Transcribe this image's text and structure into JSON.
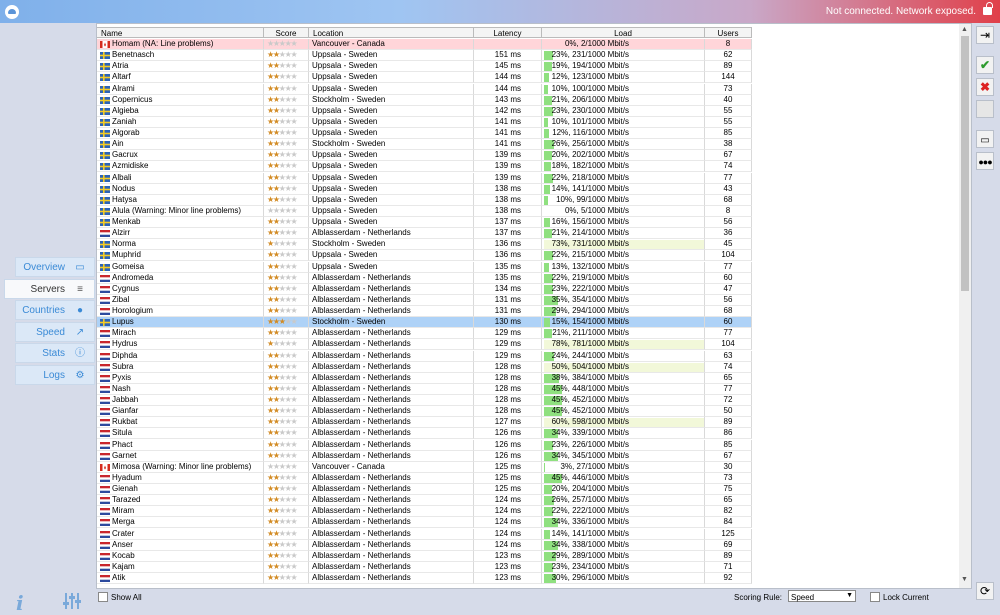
{
  "title_bar": {
    "status": "Not connected. Network exposed."
  },
  "nav": [
    {
      "label": "Overview",
      "icon": "monitor-icon"
    },
    {
      "label": "Servers",
      "icon": "server-list-icon",
      "active": true
    },
    {
      "label": "Countries",
      "icon": "globe-icon"
    },
    {
      "label": "Speed",
      "icon": "chart-line-icon"
    },
    {
      "label": "Stats",
      "icon": "info-circle-icon"
    },
    {
      "label": "Logs",
      "icon": "gears-icon"
    }
  ],
  "table": {
    "columns": [
      "Name",
      "Score",
      "Location",
      "Latency",
      "Load",
      "Users"
    ],
    "rows": [
      {
        "flag": "ca",
        "name": "Homam (NA: Line problems)",
        "score": 0,
        "location": "Vancouver - Canada",
        "latency": "",
        "load_pct": 0,
        "load": "0%, 2/1000 Mbit/s",
        "users": "8",
        "state": "problem"
      },
      {
        "flag": "se",
        "name": "Benetnasch",
        "score": 2,
        "location": "Uppsala - Sweden",
        "latency": "151 ms",
        "load_pct": 23,
        "load": "23%, 231/1000 Mbit/s",
        "users": "62"
      },
      {
        "flag": "se",
        "name": "Atria",
        "score": 2,
        "location": "Uppsala - Sweden",
        "latency": "145 ms",
        "load_pct": 19,
        "load": "19%, 194/1000 Mbit/s",
        "users": "89"
      },
      {
        "flag": "se",
        "name": "Altarf",
        "score": 2,
        "location": "Uppsala - Sweden",
        "latency": "144 ms",
        "load_pct": 12,
        "load": "12%, 123/1000 Mbit/s",
        "users": "144"
      },
      {
        "flag": "se",
        "name": "Alrami",
        "score": 2,
        "location": "Uppsala - Sweden",
        "latency": "144 ms",
        "load_pct": 10,
        "load": "10%, 100/1000 Mbit/s",
        "users": "73"
      },
      {
        "flag": "se",
        "name": "Copernicus",
        "score": 2,
        "location": "Stockholm - Sweden",
        "latency": "143 ms",
        "load_pct": 21,
        "load": "21%, 206/1000 Mbit/s",
        "users": "40"
      },
      {
        "flag": "se",
        "name": "Algieba",
        "score": 2,
        "location": "Uppsala - Sweden",
        "latency": "142 ms",
        "load_pct": 23,
        "load": "23%, 230/1000 Mbit/s",
        "users": "55"
      },
      {
        "flag": "se",
        "name": "Zaniah",
        "score": 2,
        "location": "Uppsala - Sweden",
        "latency": "141 ms",
        "load_pct": 10,
        "load": "10%, 101/1000 Mbit/s",
        "users": "55"
      },
      {
        "flag": "se",
        "name": "Algorab",
        "score": 2,
        "location": "Uppsala - Sweden",
        "latency": "141 ms",
        "load_pct": 12,
        "load": "12%, 116/1000 Mbit/s",
        "users": "85"
      },
      {
        "flag": "se",
        "name": "Ain",
        "score": 2,
        "location": "Stockholm - Sweden",
        "latency": "141 ms",
        "load_pct": 26,
        "load": "26%, 256/1000 Mbit/s",
        "users": "38"
      },
      {
        "flag": "se",
        "name": "Gacrux",
        "score": 2,
        "location": "Uppsala - Sweden",
        "latency": "139 ms",
        "load_pct": 20,
        "load": "20%, 202/1000 Mbit/s",
        "users": "67"
      },
      {
        "flag": "se",
        "name": "Azmidiske",
        "score": 2,
        "location": "Uppsala - Sweden",
        "latency": "139 ms",
        "load_pct": 18,
        "load": "18%, 182/1000 Mbit/s",
        "users": "74"
      },
      {
        "flag": "se",
        "name": "Albali",
        "score": 2,
        "location": "Uppsala - Sweden",
        "latency": "139 ms",
        "load_pct": 22,
        "load": "22%, 218/1000 Mbit/s",
        "users": "77"
      },
      {
        "flag": "se",
        "name": "Nodus",
        "score": 2,
        "location": "Uppsala - Sweden",
        "latency": "138 ms",
        "load_pct": 14,
        "load": "14%, 141/1000 Mbit/s",
        "users": "43"
      },
      {
        "flag": "se",
        "name": "Hatysa",
        "score": 2,
        "location": "Uppsala - Sweden",
        "latency": "138 ms",
        "load_pct": 10,
        "load": "10%, 99/1000 Mbit/s",
        "users": "68"
      },
      {
        "flag": "se",
        "name": "Alula (Warning: Minor line problems)",
        "score": 0,
        "location": "Uppsala - Sweden",
        "latency": "138 ms",
        "load_pct": 0,
        "load": "0%, 5/1000 Mbit/s",
        "users": "8"
      },
      {
        "flag": "se",
        "name": "Menkab",
        "score": 2,
        "location": "Uppsala - Sweden",
        "latency": "137 ms",
        "load_pct": 16,
        "load": "16%, 156/1000 Mbit/s",
        "users": "56"
      },
      {
        "flag": "nl",
        "name": "Alzirr",
        "score": 2,
        "location": "Alblasserdam - Netherlands",
        "latency": "137 ms",
        "load_pct": 21,
        "load": "21%, 214/1000 Mbit/s",
        "users": "36"
      },
      {
        "flag": "se",
        "name": "Norma",
        "score": 1,
        "location": "Stockholm - Sweden",
        "latency": "136 ms",
        "load_pct": 73,
        "load": "73%, 731/1000 Mbit/s",
        "users": "45"
      },
      {
        "flag": "se",
        "name": "Muphrid",
        "score": 2,
        "location": "Uppsala - Sweden",
        "latency": "136 ms",
        "load_pct": 22,
        "load": "22%, 215/1000 Mbit/s",
        "users": "104"
      },
      {
        "flag": "se",
        "name": "Gomeisa",
        "score": 2,
        "location": "Uppsala - Sweden",
        "latency": "135 ms",
        "load_pct": 13,
        "load": "13%, 132/1000 Mbit/s",
        "users": "77"
      },
      {
        "flag": "nl",
        "name": "Andromeda",
        "score": 2,
        "location": "Alblasserdam - Netherlands",
        "latency": "135 ms",
        "load_pct": 22,
        "load": "22%, 219/1000 Mbit/s",
        "users": "60"
      },
      {
        "flag": "nl",
        "name": "Cygnus",
        "score": 2,
        "location": "Alblasserdam - Netherlands",
        "latency": "134 ms",
        "load_pct": 23,
        "load": "23%, 222/1000 Mbit/s",
        "users": "47"
      },
      {
        "flag": "nl",
        "name": "Zibal",
        "score": 2,
        "location": "Alblasserdam - Netherlands",
        "latency": "131 ms",
        "load_pct": 35,
        "load": "35%, 354/1000 Mbit/s",
        "users": "56"
      },
      {
        "flag": "nl",
        "name": "Horologium",
        "score": 2,
        "location": "Alblasserdam - Netherlands",
        "latency": "131 ms",
        "load_pct": 29,
        "load": "29%, 294/1000 Mbit/s",
        "users": "68"
      },
      {
        "flag": "se",
        "name": "Lupus",
        "score": 3,
        "location": "Stockholm - Sweden",
        "latency": "130 ms",
        "load_pct": 15,
        "load": "15%, 154/1000 Mbit/s",
        "users": "60",
        "state": "selected"
      },
      {
        "flag": "nl",
        "name": "Mirach",
        "score": 2,
        "location": "Alblasserdam - Netherlands",
        "latency": "129 ms",
        "load_pct": 21,
        "load": "21%, 211/1000 Mbit/s",
        "users": "77"
      },
      {
        "flag": "nl",
        "name": "Hydrus",
        "score": 1,
        "location": "Alblasserdam - Netherlands",
        "latency": "129 ms",
        "load_pct": 78,
        "load": "78%, 781/1000 Mbit/s",
        "users": "104"
      },
      {
        "flag": "nl",
        "name": "Diphda",
        "score": 2,
        "location": "Alblasserdam - Netherlands",
        "latency": "129 ms",
        "load_pct": 24,
        "load": "24%, 244/1000 Mbit/s",
        "users": "63"
      },
      {
        "flag": "nl",
        "name": "Subra",
        "score": 2,
        "location": "Alblasserdam - Netherlands",
        "latency": "128 ms",
        "load_pct": 50,
        "load": "50%, 504/1000 Mbit/s",
        "users": "74"
      },
      {
        "flag": "nl",
        "name": "Pyxis",
        "score": 2,
        "location": "Alblasserdam - Netherlands",
        "latency": "128 ms",
        "load_pct": 38,
        "load": "38%, 384/1000 Mbit/s",
        "users": "65"
      },
      {
        "flag": "nl",
        "name": "Nash",
        "score": 2,
        "location": "Alblasserdam - Netherlands",
        "latency": "128 ms",
        "load_pct": 45,
        "load": "45%, 448/1000 Mbit/s",
        "users": "77"
      },
      {
        "flag": "nl",
        "name": "Jabbah",
        "score": 2,
        "location": "Alblasserdam - Netherlands",
        "latency": "128 ms",
        "load_pct": 45,
        "load": "45%, 452/1000 Mbit/s",
        "users": "72"
      },
      {
        "flag": "nl",
        "name": "Gianfar",
        "score": 2,
        "location": "Alblasserdam - Netherlands",
        "latency": "128 ms",
        "load_pct": 45,
        "load": "45%, 452/1000 Mbit/s",
        "users": "50"
      },
      {
        "flag": "nl",
        "name": "Rukbat",
        "score": 2,
        "location": "Alblasserdam - Netherlands",
        "latency": "127 ms",
        "load_pct": 60,
        "load": "60%, 598/1000 Mbit/s",
        "users": "89"
      },
      {
        "flag": "nl",
        "name": "Situla",
        "score": 2,
        "location": "Alblasserdam - Netherlands",
        "latency": "126 ms",
        "load_pct": 34,
        "load": "34%, 339/1000 Mbit/s",
        "users": "86"
      },
      {
        "flag": "nl",
        "name": "Phact",
        "score": 2,
        "location": "Alblasserdam - Netherlands",
        "latency": "126 ms",
        "load_pct": 23,
        "load": "23%, 226/1000 Mbit/s",
        "users": "85"
      },
      {
        "flag": "nl",
        "name": "Garnet",
        "score": 2,
        "location": "Alblasserdam - Netherlands",
        "latency": "126 ms",
        "load_pct": 34,
        "load": "34%, 345/1000 Mbit/s",
        "users": "67"
      },
      {
        "flag": "ca",
        "name": "Mimosa (Warning: Minor line problems)",
        "score": 0,
        "location": "Vancouver - Canada",
        "latency": "125 ms",
        "load_pct": 3,
        "load": "3%, 27/1000 Mbit/s",
        "users": "30"
      },
      {
        "flag": "nl",
        "name": "Hyadum",
        "score": 2,
        "location": "Alblasserdam - Netherlands",
        "latency": "125 ms",
        "load_pct": 45,
        "load": "45%, 446/1000 Mbit/s",
        "users": "73"
      },
      {
        "flag": "nl",
        "name": "Gienah",
        "score": 2,
        "location": "Alblasserdam - Netherlands",
        "latency": "125 ms",
        "load_pct": 20,
        "load": "20%, 204/1000 Mbit/s",
        "users": "75"
      },
      {
        "flag": "nl",
        "name": "Tarazed",
        "score": 2,
        "location": "Alblasserdam - Netherlands",
        "latency": "124 ms",
        "load_pct": 26,
        "load": "26%, 257/1000 Mbit/s",
        "users": "65"
      },
      {
        "flag": "nl",
        "name": "Miram",
        "score": 2,
        "location": "Alblasserdam - Netherlands",
        "latency": "124 ms",
        "load_pct": 22,
        "load": "22%, 222/1000 Mbit/s",
        "users": "82"
      },
      {
        "flag": "nl",
        "name": "Merga",
        "score": 2,
        "location": "Alblasserdam - Netherlands",
        "latency": "124 ms",
        "load_pct": 34,
        "load": "34%, 336/1000 Mbit/s",
        "users": "84"
      },
      {
        "flag": "nl",
        "name": "Crater",
        "score": 2,
        "location": "Alblasserdam - Netherlands",
        "latency": "124 ms",
        "load_pct": 14,
        "load": "14%, 141/1000 Mbit/s",
        "users": "125"
      },
      {
        "flag": "nl",
        "name": "Anser",
        "score": 2,
        "location": "Alblasserdam - Netherlands",
        "latency": "124 ms",
        "load_pct": 34,
        "load": "34%, 338/1000 Mbit/s",
        "users": "69"
      },
      {
        "flag": "nl",
        "name": "Kocab",
        "score": 2,
        "location": "Alblasserdam - Netherlands",
        "latency": "123 ms",
        "load_pct": 29,
        "load": "29%, 289/1000 Mbit/s",
        "users": "89"
      },
      {
        "flag": "nl",
        "name": "Kajam",
        "score": 2,
        "location": "Alblasserdam - Netherlands",
        "latency": "123 ms",
        "load_pct": 23,
        "load": "23%, 234/1000 Mbit/s",
        "users": "71"
      },
      {
        "flag": "nl",
        "name": "Atik",
        "score": 2,
        "location": "Alblasserdam - Netherlands",
        "latency": "123 ms",
        "load_pct": 30,
        "load": "30%, 296/1000 Mbit/s",
        "users": "92"
      }
    ]
  },
  "footer": {
    "show_all": "Show All",
    "scoring_rule_label": "Scoring Rule:",
    "scoring_rule_value": "Speed",
    "lock_current": "Lock Current"
  },
  "right_toolbar": [
    "login-icon",
    "checkmark-icon",
    "cross-icon",
    "blank-button",
    "remote-icon",
    "more-icon",
    "refresh-icon"
  ],
  "colors": {
    "bar_high": "#8fe07f",
    "bar_low": "#f2f8d9",
    "problem_row": "#ffd5d9",
    "selected_row": "#aed2f7",
    "star": "#d28b24"
  }
}
